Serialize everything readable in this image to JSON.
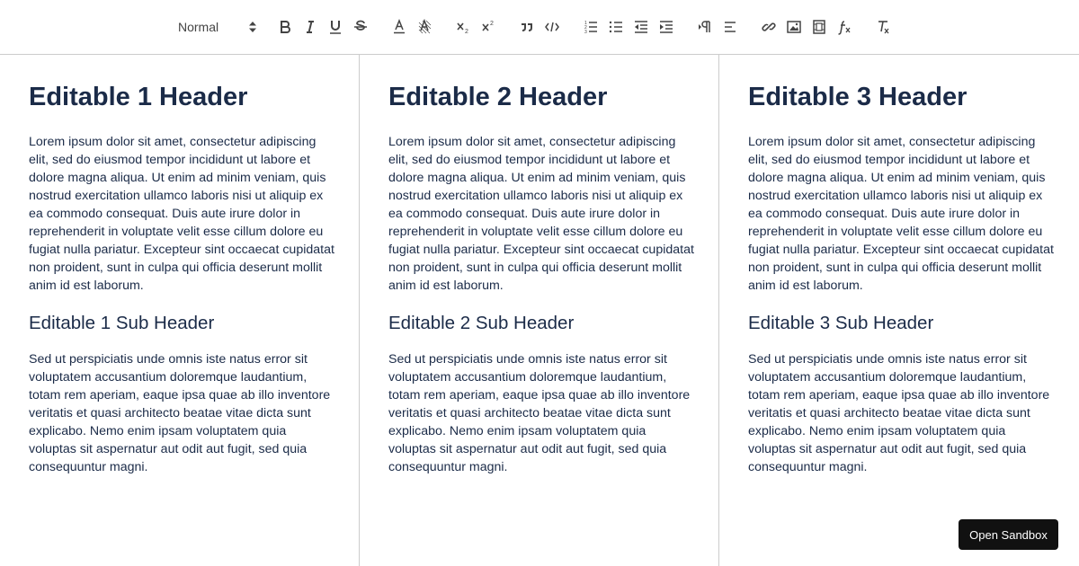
{
  "toolbar": {
    "format_value": "Normal",
    "icons": [
      "bold-icon",
      "italic-icon",
      "underline-icon",
      "strike-icon",
      "font-color-icon",
      "background-color-icon",
      "subscript-icon",
      "superscript-icon",
      "blockquote-icon",
      "code-block-icon",
      "ordered-list-icon",
      "bullet-list-icon",
      "outdent-icon",
      "indent-icon",
      "text-direction-icon",
      "align-icon",
      "link-icon",
      "image-icon",
      "video-icon",
      "formula-icon",
      "clear-format-icon"
    ]
  },
  "columns": [
    {
      "header": "Editable 1 Header",
      "body": "Lorem ipsum dolor sit amet, consectetur adipiscing elit, sed do eiusmod tempor incididunt ut labore et dolore magna aliqua. Ut enim ad minim veniam, quis nostrud exercitation ullamco laboris nisi ut aliquip ex ea commodo consequat. Duis aute irure dolor in reprehenderit in voluptate velit esse cillum dolore eu fugiat nulla pariatur. Excepteur sint occaecat cupidatat non proident, sunt in culpa qui officia deserunt mollit anim id est laborum.",
      "subheader": "Editable 1 Sub Header",
      "subbody": "Sed ut perspiciatis unde omnis iste natus error sit voluptatem accusantium doloremque laudantium, totam rem aperiam, eaque ipsa quae ab illo inventore veritatis et quasi architecto beatae vitae dicta sunt explicabo. Nemo enim ipsam voluptatem quia voluptas sit aspernatur aut odit aut fugit, sed quia consequuntur magni."
    },
    {
      "header": "Editable 2 Header",
      "body": "Lorem ipsum dolor sit amet, consectetur adipiscing elit, sed do eiusmod tempor incididunt ut labore et dolore magna aliqua. Ut enim ad minim veniam, quis nostrud exercitation ullamco laboris nisi ut aliquip ex ea commodo consequat. Duis aute irure dolor in reprehenderit in voluptate velit esse cillum dolore eu fugiat nulla pariatur. Excepteur sint occaecat cupidatat non proident, sunt in culpa qui officia deserunt mollit anim id est laborum.",
      "subheader": "Editable 2 Sub Header",
      "subbody": "Sed ut perspiciatis unde omnis iste natus error sit voluptatem accusantium doloremque laudantium, totam rem aperiam, eaque ipsa quae ab illo inventore veritatis et quasi architecto beatae vitae dicta sunt explicabo. Nemo enim ipsam voluptatem quia voluptas sit aspernatur aut odit aut fugit, sed quia consequuntur magni."
    },
    {
      "header": "Editable 3 Header",
      "body": "Lorem ipsum dolor sit amet, consectetur adipiscing elit, sed do eiusmod tempor incididunt ut labore et dolore magna aliqua. Ut enim ad minim veniam, quis nostrud exercitation ullamco laboris nisi ut aliquip ex ea commodo consequat. Duis aute irure dolor in reprehenderit in voluptate velit esse cillum dolore eu fugiat nulla pariatur. Excepteur sint occaecat cupidatat non proident, sunt in culpa qui officia deserunt mollit anim id est laborum.",
      "subheader": "Editable 3 Sub Header",
      "subbody": "Sed ut perspiciatis unde omnis iste natus error sit voluptatem accusantium doloremque laudantium, totam rem aperiam, eaque ipsa quae ab illo inventore veritatis et quasi architecto beatae vitae dicta sunt explicabo. Nemo enim ipsam voluptatem quia voluptas sit aspernatur aut odit aut fugit, sed quia consequuntur magni."
    }
  ],
  "sandbox_button": "Open Sandbox",
  "colors": {
    "heading": "#1b2b48",
    "toolbar_icon": "#444444",
    "divider": "#cccccc",
    "button_bg": "#111111"
  }
}
